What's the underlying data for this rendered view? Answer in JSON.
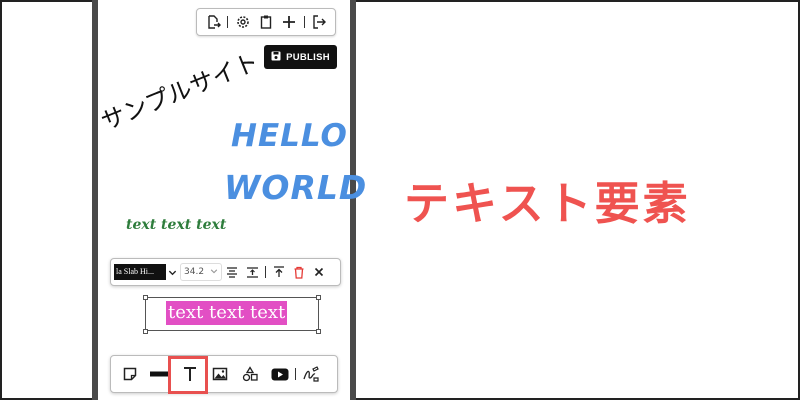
{
  "top_toolbar": {
    "icons": [
      "export-icon",
      "settings-icon",
      "clipboard-icon",
      "add-icon",
      "logout-icon"
    ]
  },
  "publish": {
    "label": "PUBLISH",
    "icon": "save-icon"
  },
  "canvas": {
    "sample_text": "サンプルサイト",
    "hello": "HELLO",
    "world": "WORLD",
    "green_text": "text text text",
    "selected_text": "text text text"
  },
  "format_toolbar": {
    "font_name": "la Slab Hi...",
    "font_size": "34.2",
    "icons": [
      "align-icon",
      "line-spacing-icon",
      "bring-front-icon",
      "delete-icon",
      "close-icon"
    ]
  },
  "bottom_toolbar": {
    "icons": [
      "sticky-note-icon",
      "line-icon",
      "text-icon",
      "image-icon",
      "shapes-icon",
      "youtube-icon",
      "sign-icon"
    ],
    "active": "text-icon"
  },
  "caption": "テキスト要素",
  "colors": {
    "accent": "#ef5350",
    "blue_text": "#4b8fe0",
    "green_text": "#2e7d3c",
    "highlight": "#e24fc4",
    "publish_bg": "#111111"
  }
}
